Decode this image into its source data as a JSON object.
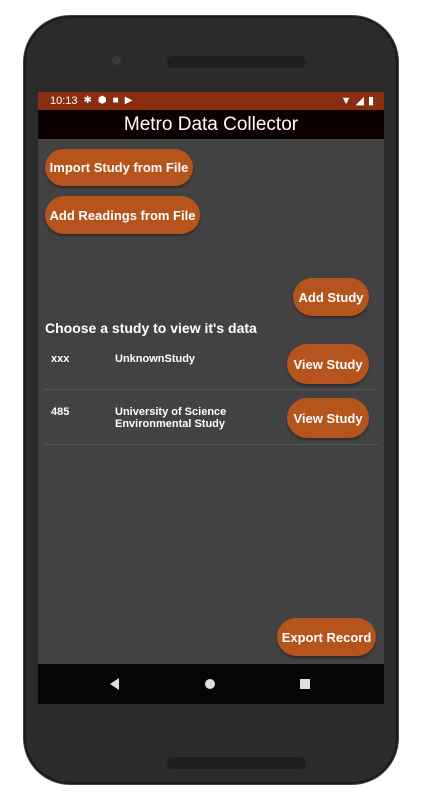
{
  "status_bar": {
    "time": "10:13",
    "icons": [
      "gear-icon",
      "shield-icon",
      "sd-card-icon",
      "play-icon"
    ],
    "right_icons": [
      "wifi-icon",
      "signal-icon",
      "battery-icon"
    ]
  },
  "app_bar": {
    "title": "Metro Data Collector"
  },
  "buttons": {
    "import_study": "Import Study from File",
    "add_readings": "Add Readings from File",
    "add_study": "Add Study",
    "export_record": "Export Record"
  },
  "section_title": "Choose a study to view it's data",
  "studies": [
    {
      "id": "xxx",
      "name": "UnknownStudy",
      "button": "View Study"
    },
    {
      "id": "485",
      "name": "University of Science Environmental Study",
      "button": "View Study"
    }
  ],
  "colors": {
    "accent": "#b5541c",
    "status_bar": "#8a2e12",
    "app_bar": "#0d0000",
    "background": "#424242"
  }
}
